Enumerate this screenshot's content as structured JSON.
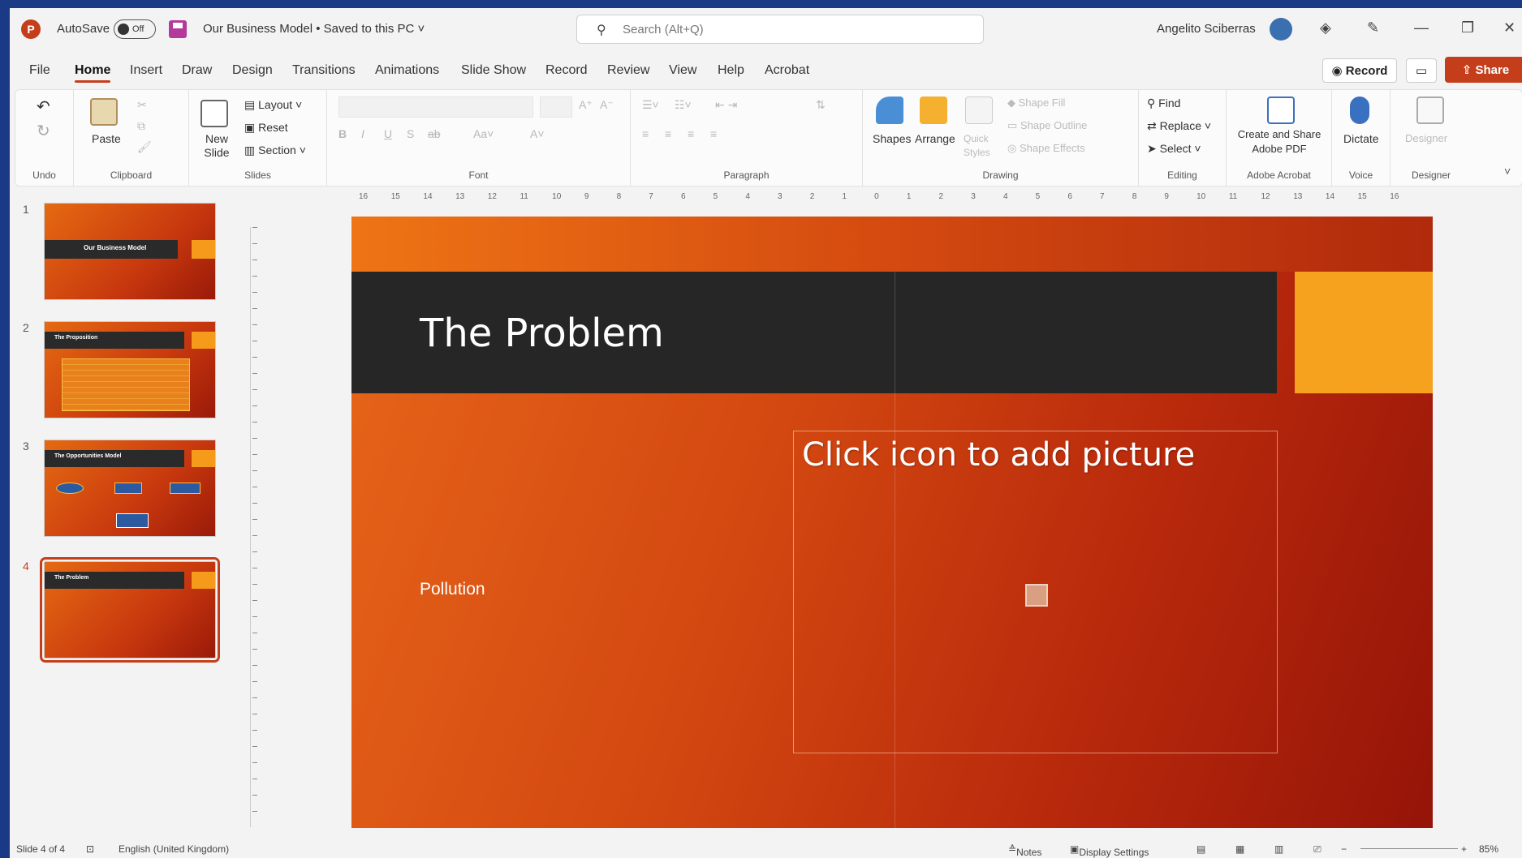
{
  "titlebar": {
    "autosave_label": "AutoSave",
    "autosave_state": "Off",
    "document_title": "Our Business Model • Saved to this PC ˅",
    "search_placeholder": "Search (Alt+Q)",
    "user_name": "Angelito Sciberras"
  },
  "menu": {
    "tabs": [
      "File",
      "Home",
      "Insert",
      "Draw",
      "Design",
      "Transitions",
      "Animations",
      "Slide Show",
      "Record",
      "Review",
      "View",
      "Help",
      "Acrobat"
    ],
    "active_tab": "Home",
    "record_button": "Record",
    "share_button": "Share"
  },
  "ribbon": {
    "undo_group": "Undo",
    "clipboard": {
      "paste": "Paste",
      "label": "Clipboard"
    },
    "slides": {
      "new_slide": "New Slide",
      "layout": "Layout",
      "reset": "Reset",
      "section": "Section",
      "label": "Slides"
    },
    "font": {
      "label": "Font"
    },
    "paragraph": {
      "label": "Paragraph"
    },
    "drawing": {
      "shapes": "Shapes",
      "arrange": "Arrange",
      "quick_styles": "Quick Styles",
      "shape_fill": "Shape Fill",
      "shape_outline": "Shape Outline",
      "shape_effects": "Shape Effects",
      "label": "Drawing"
    },
    "editing": {
      "find": "Find",
      "replace": "Replace",
      "select": "Select",
      "label": "Editing"
    },
    "adobe": {
      "create_share": "Create and Share Adobe PDF",
      "label": "Adobe Acrobat"
    },
    "voice": {
      "dictate": "Dictate",
      "label": "Voice"
    },
    "designer": {
      "designer": "Designer",
      "label": "Designer"
    }
  },
  "ruler": {
    "ticks": [
      "16",
      "15",
      "14",
      "13",
      "12",
      "11",
      "10",
      "9",
      "8",
      "7",
      "6",
      "5",
      "4",
      "3",
      "2",
      "1",
      "0",
      "1",
      "2",
      "3",
      "4",
      "5",
      "6",
      "7",
      "8",
      "9",
      "10",
      "11",
      "12",
      "13",
      "14",
      "15",
      "16"
    ]
  },
  "thumbnails": [
    {
      "number": "1",
      "title": "Our Business Model"
    },
    {
      "number": "2",
      "title": "The Proposition"
    },
    {
      "number": "3",
      "title": "The Opportunities Model"
    },
    {
      "number": "4",
      "title": "The Problem"
    }
  ],
  "slide": {
    "title": "The Problem",
    "body": "Pollution",
    "picture_placeholder": "Click icon to add picture"
  },
  "statusbar": {
    "slide_position": "Slide 4 of 4",
    "language": "English (United Kingdom)",
    "notes": "Notes",
    "display_settings": "Display Settings",
    "zoom": "85%"
  },
  "colors": {
    "accent": "#c43e1c",
    "slide_orange": "#f6a21e",
    "title_bar": "#262626"
  }
}
